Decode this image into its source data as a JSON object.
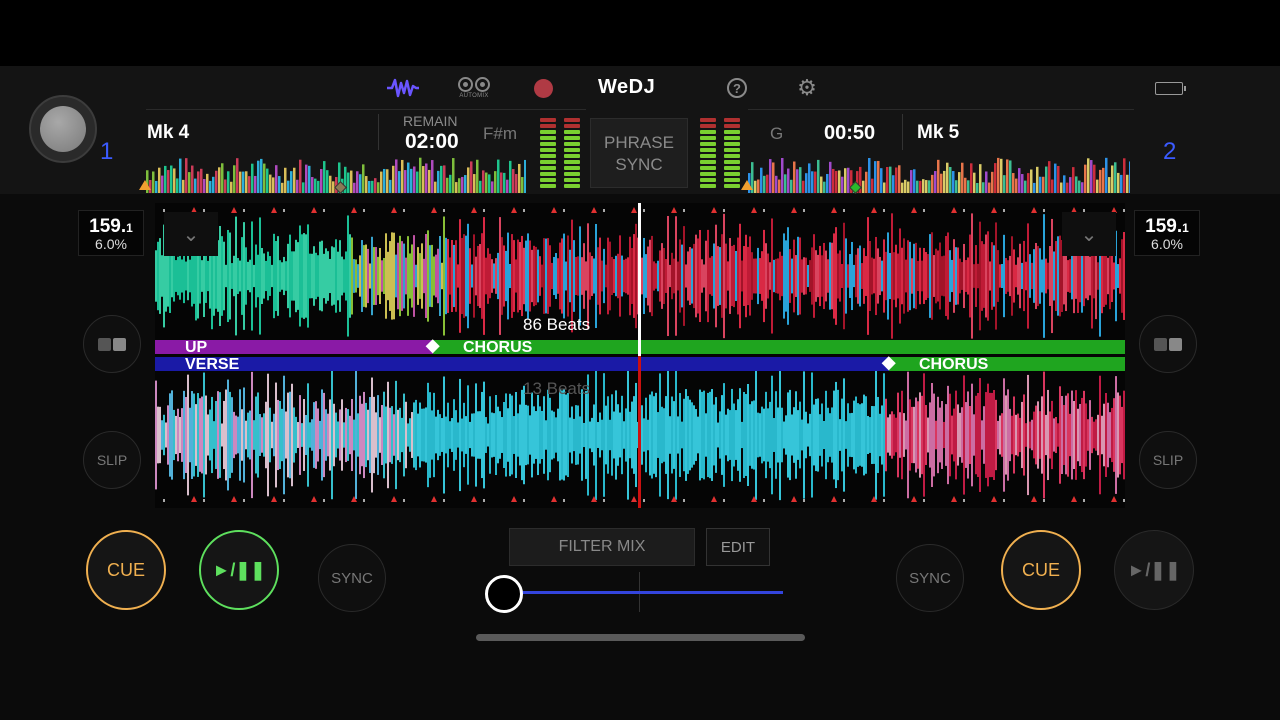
{
  "app": {
    "name": "WeDJ",
    "automix_label": "AUTOMIX"
  },
  "toolbar": {
    "icons": [
      "waveform-icon",
      "automix-icon",
      "record-icon",
      "help-icon",
      "settings-icon",
      "battery-icon"
    ],
    "help_glyph": "?",
    "gear_glyph": "⚙"
  },
  "deck1": {
    "number": "1",
    "track": "Mk 4",
    "remain_label": "REMAIN",
    "remain_time": "02:00",
    "key": "F#m",
    "bpm_main": "159.",
    "bpm_decimal": "1",
    "pitch": "6.0%",
    "beats": "86 Beats",
    "phrase_a": "UP",
    "phrase_b": "CHORUS"
  },
  "deck2": {
    "number": "2",
    "track": "Mk 5",
    "time": "00:50",
    "key": "G",
    "bpm_main": "159.",
    "bpm_decimal": "1",
    "pitch": "6.0%",
    "beats": "13 Beats",
    "phrase_a": "VERSE",
    "phrase_b": "CHORUS"
  },
  "center": {
    "phrase_sync_line1": "PHRASE",
    "phrase_sync_line2": "SYNC",
    "filter_mix": "FILTER MIX",
    "edit": "EDIT",
    "crossfader_position": 0.0
  },
  "buttons": {
    "cue": "CUE",
    "play": "►/❚❚",
    "sync": "SYNC",
    "slip": "SLIP",
    "chevron": "⌄"
  },
  "colors": {
    "accent_blue": "#3b5bff",
    "cue_orange": "#f0b050",
    "play_green": "#5ee05e",
    "record_red": "#b03a44",
    "phrase_purple": "#8a1aa6",
    "phrase_green": "#1fa51f",
    "phrase_blue": "#1a1aa6",
    "playhead_white": "#ffffff",
    "playhead_red": "#cc1010"
  }
}
